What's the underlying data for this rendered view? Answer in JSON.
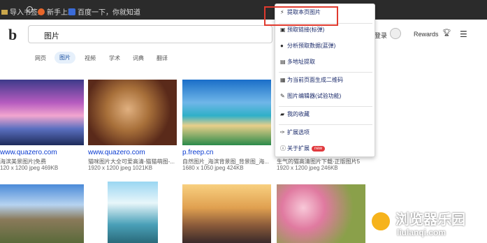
{
  "bookmarks": {
    "items": [
      {
        "label": "导入书签...",
        "icon": "bookmark-folder-icon"
      },
      {
        "label": "⓵",
        "icon": "info-icon"
      },
      {
        "label": "新手上路",
        "icon": "firefox-icon"
      },
      {
        "label": "百度一下，你就知道",
        "icon": "baidu-icon"
      }
    ]
  },
  "search": {
    "logo": "b",
    "query": "图片"
  },
  "header": {
    "login": "登录",
    "rewards": "Rewards"
  },
  "tabs": [
    {
      "label": "网页"
    },
    {
      "label": "图片",
      "active": true
    },
    {
      "label": "视频"
    },
    {
      "label": "学术"
    },
    {
      "label": "词典"
    },
    {
      "label": "翻译"
    }
  ],
  "results": [
    {
      "source": "www.quazero.com",
      "title": "海滨美景图片|免费",
      "meta": "120 x 1200 jpeg 469KB",
      "palette": [
        "#2b2f7a",
        "#c25ab0",
        "#f6a1c8",
        "#3a5ea8"
      ]
    },
    {
      "source": "www.quazero.com",
      "title": "猫咪图片大全可爱高清-猫猫萌图-...",
      "meta": "1920 x 1200 jpeg 1021KB",
      "palette": [
        "#5a3b2a",
        "#d19b5c",
        "#8a2a2a",
        "#3a2a1a"
      ]
    },
    {
      "source": "p.freep.cn",
      "title": "自然图片_海滨背景图_背景图_海...",
      "meta": "1680 x 1050 jpeg 424KB",
      "palette": [
        "#1d6fc2",
        "#4fc0d6",
        "#e8c57a",
        "#2b8a4a"
      ]
    },
    {
      "source": "",
      "title": "生气的猫高清图片下载-正版图片5",
      "meta": "1920 x 1200 jpeg 246KB",
      "palette": [
        "#2e3a2a",
        "#8a6a3a",
        "#d8a36a",
        "#4a3a2a"
      ]
    }
  ],
  "row2": [
    {
      "palette": [
        "#3a73c8",
        "#f0e6c0",
        "#6a7a4a"
      ]
    },
    {
      "palette": [
        "#8ad0f0",
        "#ffffff",
        "#3a8aa0"
      ]
    },
    {
      "palette": [
        "#f6c86a",
        "#c88a3a",
        "#3a2a2a"
      ]
    },
    {
      "palette": [
        "#f6c0d0",
        "#e06a90",
        "#6a8a3a"
      ]
    }
  ],
  "menu": {
    "items": [
      {
        "label": "提取本页图片",
        "icon": "lightning-icon"
      },
      {
        "label": "预取链接(标弹)",
        "icon": "image-icon"
      },
      {
        "label": "分析预取数据(蓝弹)",
        "icon": "globe-icon"
      },
      {
        "label": "多地址提取",
        "icon": "list-icon"
      },
      {
        "label": "为当前页面生成二维码",
        "icon": "qrcode-icon"
      },
      {
        "label": "图片编辑器(试验功能)",
        "icon": "edit-icon"
      },
      {
        "label": "我的收藏",
        "icon": "folder-icon"
      },
      {
        "label": "扩展选项",
        "icon": "wrench-icon"
      },
      {
        "label": "关于扩展",
        "icon": "info-circle-icon",
        "badge": "new"
      }
    ]
  },
  "watermark": {
    "title": "浏览器乐园",
    "sub": "liulanqi.com"
  },
  "colors": {
    "highlight": "#e03a2e",
    "link": "#0a3bd0",
    "dark_bar": "#2b2b2b"
  }
}
